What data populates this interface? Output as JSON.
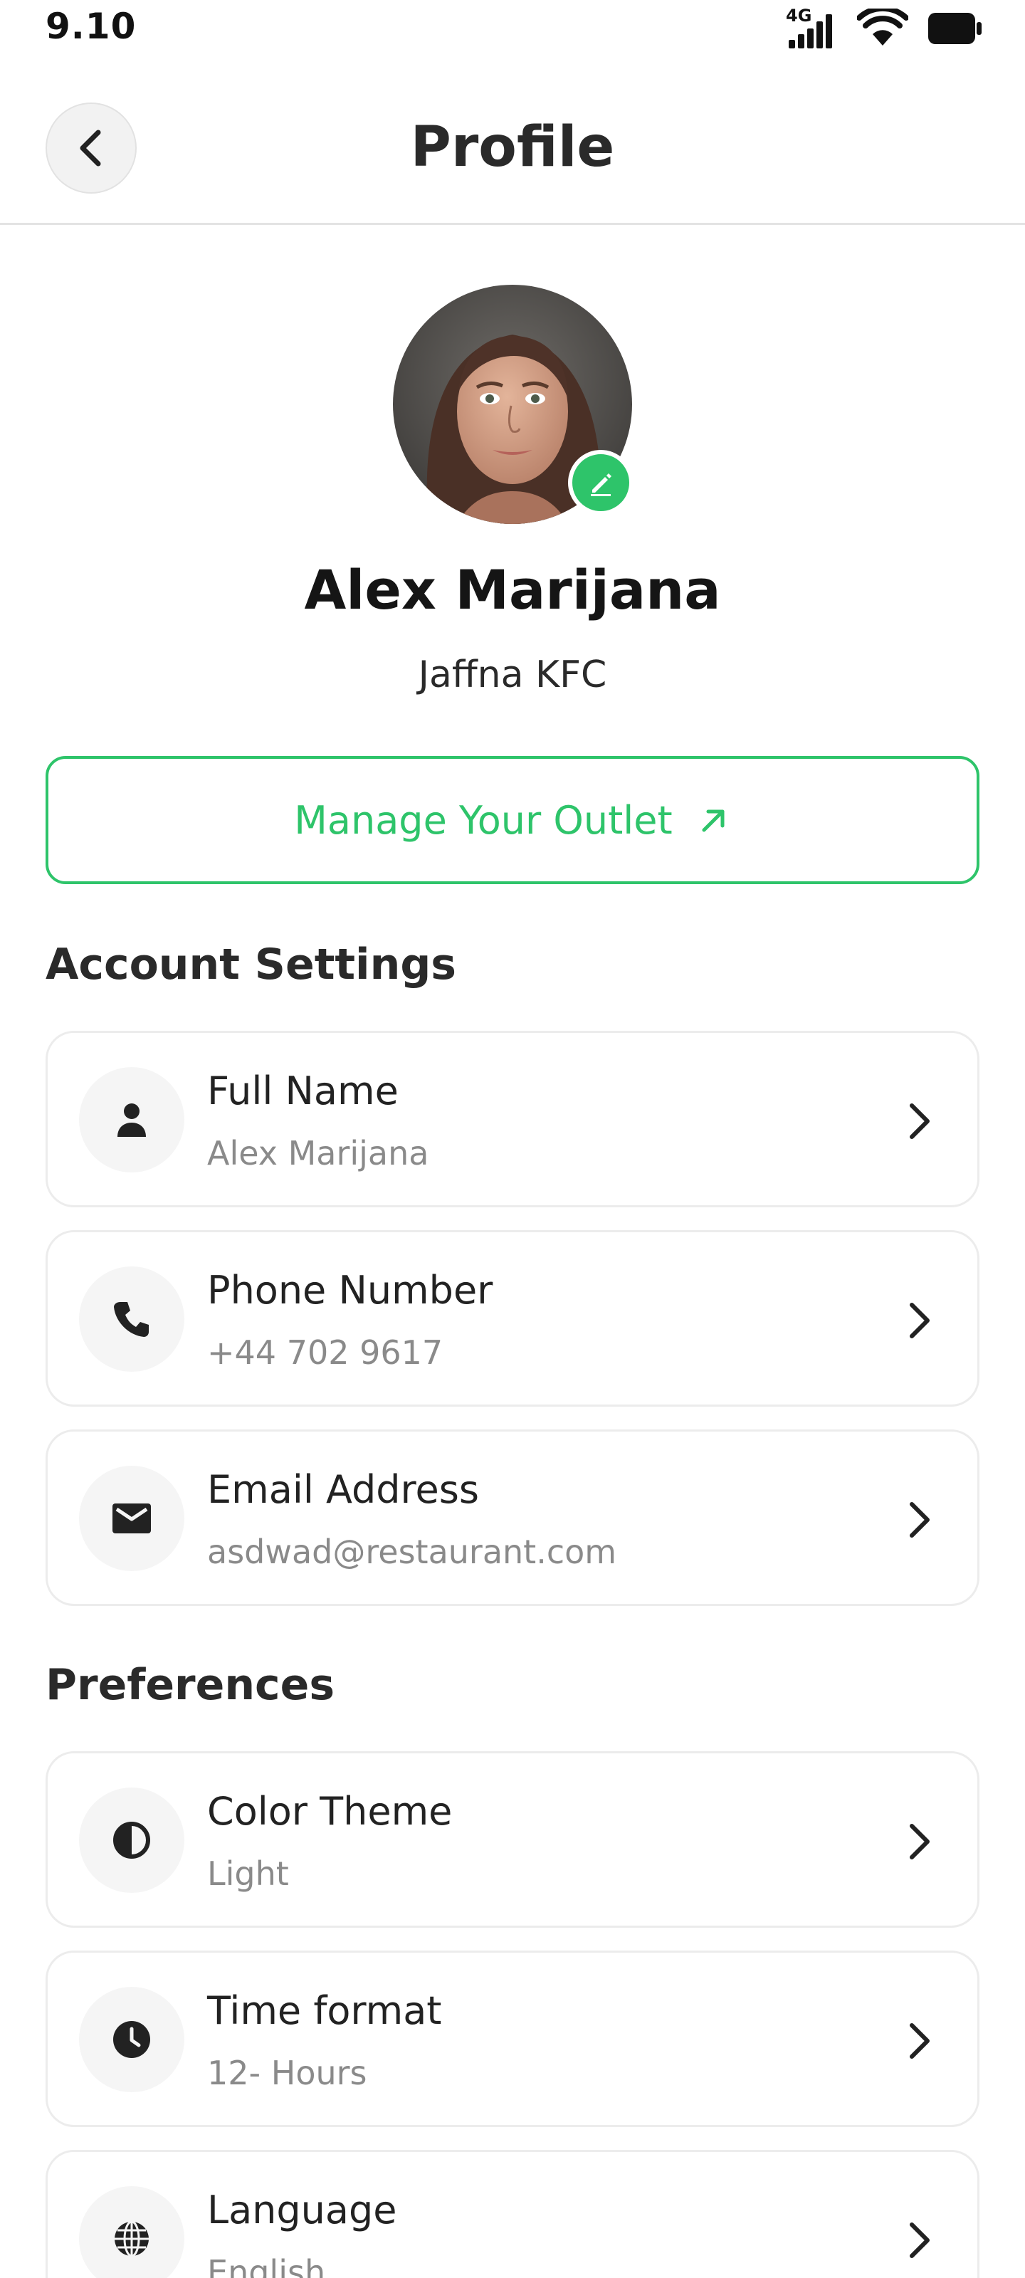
{
  "status_bar": {
    "time": "9.10",
    "network": "4G",
    "icons": [
      "signal-icon",
      "wifi-icon",
      "battery-icon"
    ]
  },
  "header": {
    "title": "Profile",
    "back_icon": "chevron-left-icon"
  },
  "profile": {
    "name": "Alex Marijana",
    "outlet": "Jaffna KFC",
    "edit_icon": "pencil-icon"
  },
  "manage_button": {
    "label": "Manage Your Outlet",
    "icon": "arrow-up-right-icon"
  },
  "account_settings": {
    "title": "Account Settings",
    "items": [
      {
        "label": "Full Name",
        "value": "Alex Marijana",
        "icon": "person-icon"
      },
      {
        "label": "Phone Number",
        "value": "+44 702 9617",
        "icon": "phone-icon"
      },
      {
        "label": "Email Address",
        "value": "asdwad@restaurant.com",
        "icon": "mail-icon"
      }
    ]
  },
  "preferences": {
    "title": "Preferences",
    "items": [
      {
        "label": "Color Theme",
        "value": "Light",
        "icon": "contrast-icon"
      },
      {
        "label": "Time format",
        "value": "12- Hours",
        "icon": "clock-icon"
      },
      {
        "label": "Language",
        "value": "English",
        "icon": "globe-icon"
      }
    ]
  },
  "colors": {
    "accent": "#2ec46a",
    "text_primary": "#222222",
    "text_secondary": "#8a8a8a",
    "card_border": "#ececec"
  }
}
